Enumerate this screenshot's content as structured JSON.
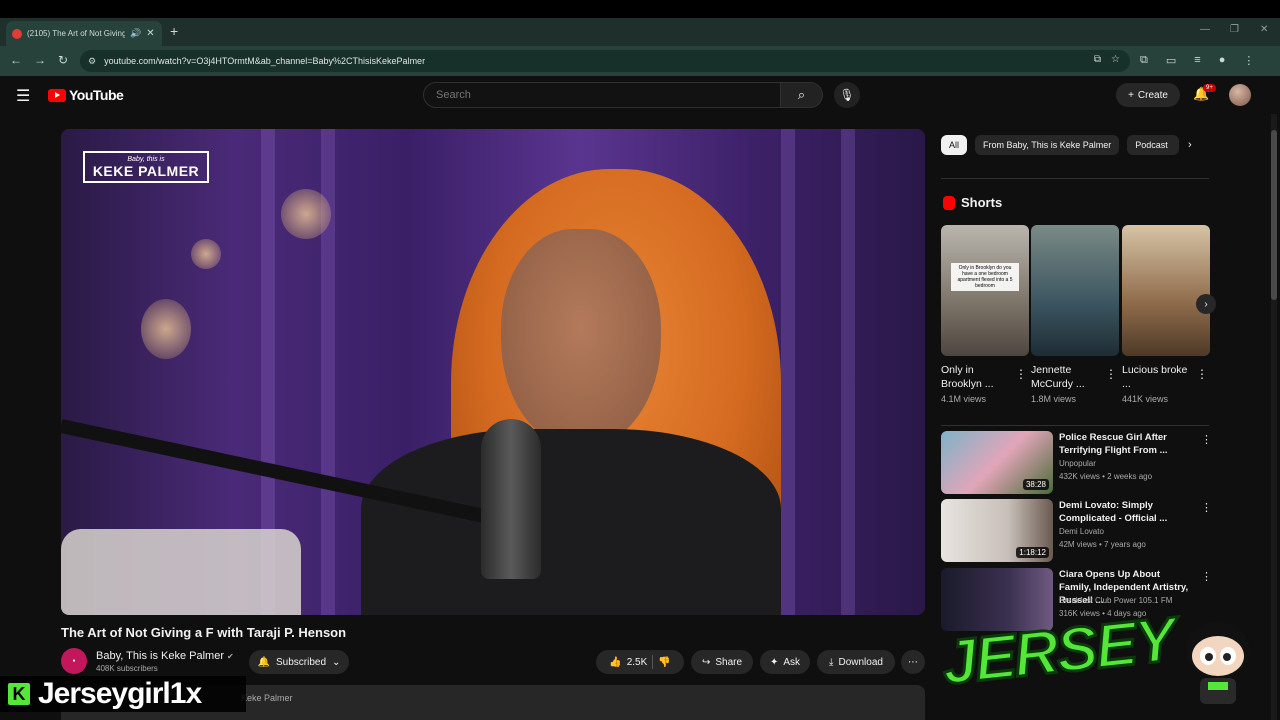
{
  "browser": {
    "tab_title": "(2105) The Art of Not Giving",
    "url": "youtube.com/watch?v=O3j4HTOrmtM&ab_channel=Baby%2CThisisKekePalmer"
  },
  "header": {
    "logo_text": "YouTube",
    "search_placeholder": "Search",
    "create_label": "Create",
    "notification_count": "9+"
  },
  "player": {
    "show_logo_small": "Baby, this is",
    "show_logo_big": "KEKE PALMER"
  },
  "video": {
    "title": "The Art of Not Giving a F with Taraji P. Henson",
    "channel_name": "Baby, This is Keke Palmer",
    "subscribers": "408K subscribers",
    "subscribed_label": "Subscribed",
    "likes": "2.5K",
    "share_label": "Share",
    "ask_label": "Ask",
    "download_label": "Download",
    "description_preview": "Keke Palmer"
  },
  "sidebar": {
    "chips": [
      "All",
      "From Baby, This is Keke Palmer",
      "Podcast"
    ],
    "shorts_label": "Shorts",
    "shorts": [
      {
        "title": "Only in Brooklyn ...",
        "views": "4.1M views",
        "caption": "Only in Brooklyn do you have a one bedroom apartment flexed into a 5 bedroom"
      },
      {
        "title": "Jennette McCurdy ...",
        "views": "1.8M views",
        "caption": ""
      },
      {
        "title": "Lucious broke ...",
        "views": "441K views",
        "caption": ""
      }
    ],
    "recommended": [
      {
        "title": "Police Rescue Girl After Terrifying Flight From ...",
        "channel": "Unpopular",
        "meta": "432K views • 2 weeks ago",
        "duration": "38:28"
      },
      {
        "title": "Demi Lovato: Simply Complicated - Official ...",
        "channel": "Demi Lovato",
        "meta": "42M views • 7 years ago",
        "duration": "1:18:12"
      },
      {
        "title": "Ciara Opens Up About Family, Independent Artistry, Russell ...",
        "channel": "Breakfast Club Power 105.1 FM",
        "meta": "316K views • 4 days ago",
        "duration": ""
      }
    ]
  },
  "overlay": {
    "handle": "Jerseygirl1x",
    "k_badge": "K",
    "jersey_text": "JERSEY"
  },
  "colors": {
    "background": "#0f0f0f",
    "brand_red": "#ff0000",
    "browser_frame": "#26423b",
    "overlay_green": "#55e63a"
  }
}
